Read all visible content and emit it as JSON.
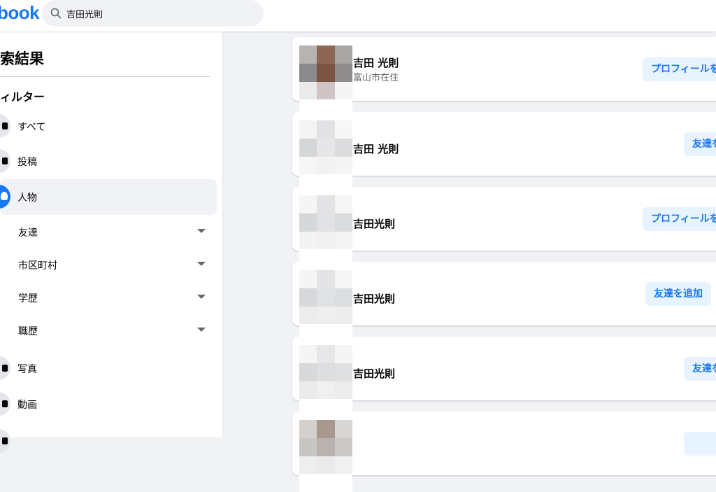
{
  "header": {
    "logo_text": "book",
    "search_value": "吉田光則"
  },
  "sidebar": {
    "title": "索結果",
    "filter_heading": "ィルター",
    "items": [
      {
        "label": "すべて",
        "icon": "feed-icon"
      },
      {
        "label": "投稿",
        "icon": "posts-icon"
      },
      {
        "label": "人物",
        "icon": "people-icon",
        "active": true
      }
    ],
    "people_filters": [
      {
        "label": "友達"
      },
      {
        "label": "市区町村"
      },
      {
        "label": "学歴"
      },
      {
        "label": "職歴"
      }
    ],
    "more_items": [
      {
        "label": "写真",
        "icon": "photos-icon"
      },
      {
        "label": "動画",
        "icon": "videos-icon"
      }
    ]
  },
  "results": [
    {
      "name": "吉田 光則",
      "subtitle": "富山市在住",
      "action": "プロフィールを"
    },
    {
      "name": "吉田 光則",
      "subtitle": "",
      "action": "友達を"
    },
    {
      "name": "吉田光則",
      "subtitle": "",
      "action": "プロフィールを"
    },
    {
      "name": "吉田光則",
      "subtitle": "",
      "action": "友達を追加"
    },
    {
      "name": "吉田光則",
      "subtitle": "",
      "action": "友達を"
    }
  ],
  "colors": {
    "brand": "#1877f2",
    "button_bg": "#e7f3ff",
    "page_bg": "#f0f2f5"
  }
}
